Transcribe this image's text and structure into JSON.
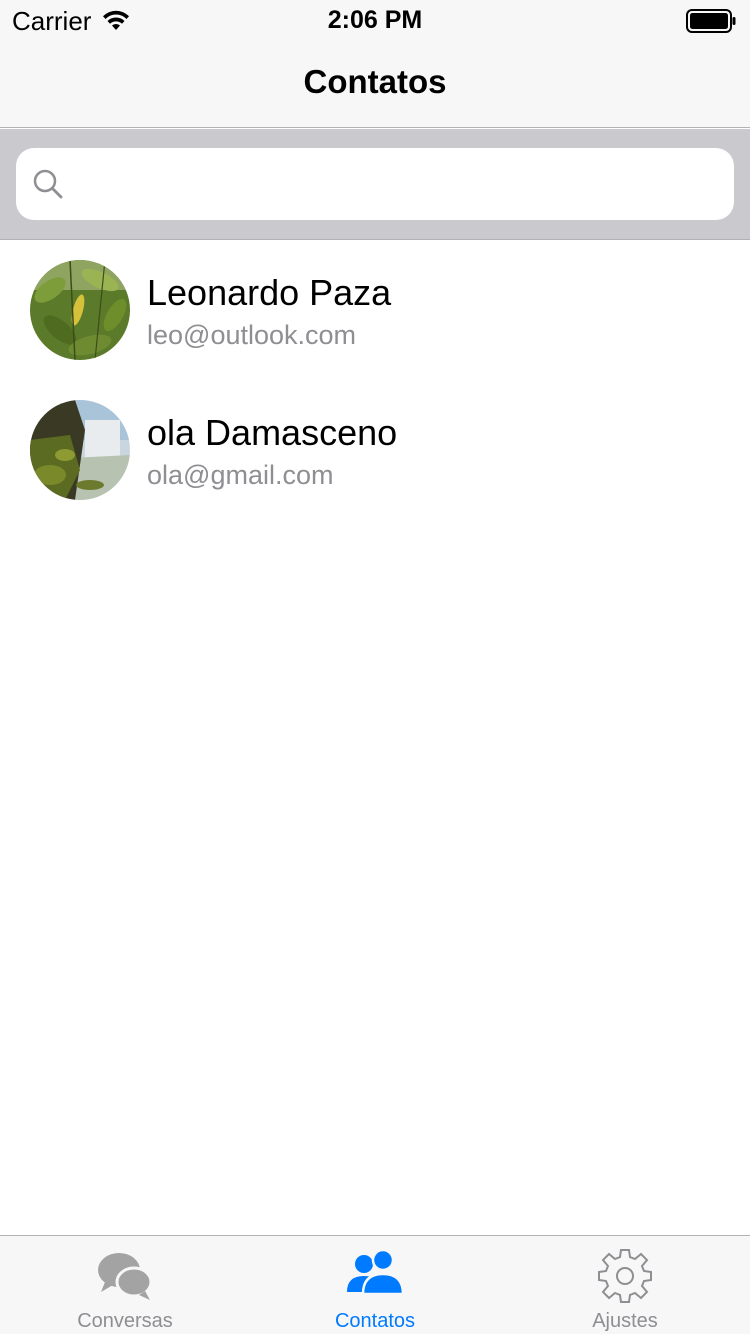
{
  "status_bar": {
    "carrier": "Carrier",
    "time": "2:06 PM"
  },
  "nav": {
    "title": "Contatos"
  },
  "search": {
    "value": "",
    "placeholder": ""
  },
  "contacts": [
    {
      "name": "Leonardo Paza",
      "email": "leo@outlook.com"
    },
    {
      "name": "ola Damasceno",
      "email": "ola@gmail.com"
    }
  ],
  "tabs": [
    {
      "label": "Conversas",
      "icon": "chat-bubbles-icon",
      "active": false
    },
    {
      "label": "Contatos",
      "icon": "people-icon",
      "active": true
    },
    {
      "label": "Ajustes",
      "icon": "gear-icon",
      "active": false
    }
  ],
  "colors": {
    "accent": "#007aff",
    "inactive": "#8e8e93",
    "search_bg": "#c9c9ce"
  }
}
